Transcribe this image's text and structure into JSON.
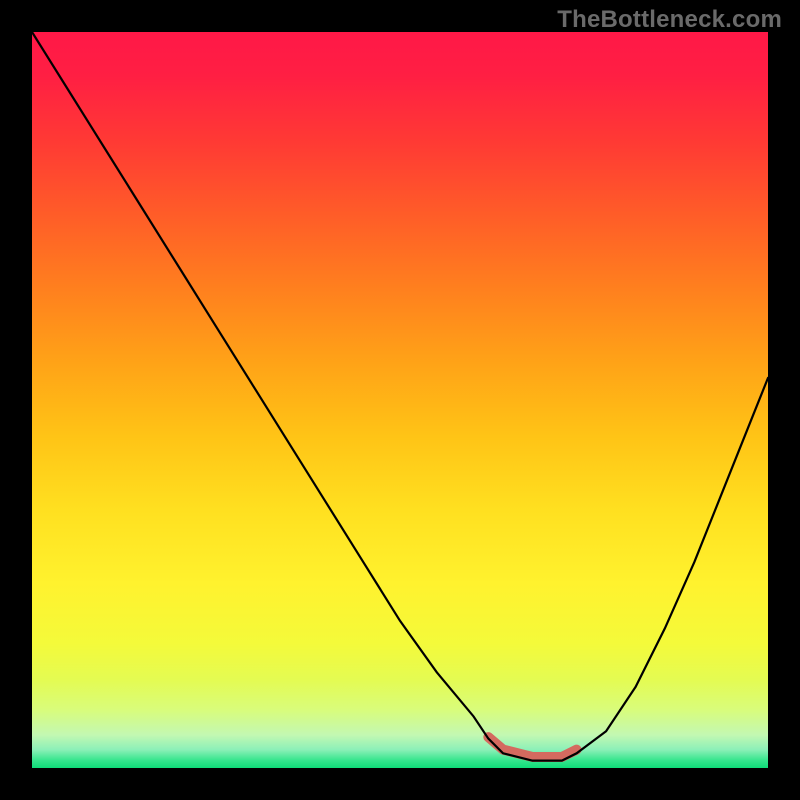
{
  "watermark": "TheBottleneck.com",
  "gradient_stops": [
    {
      "offset": 0.0,
      "color": "#ff1847"
    },
    {
      "offset": 0.06,
      "color": "#ff1f43"
    },
    {
      "offset": 0.15,
      "color": "#ff3a34"
    },
    {
      "offset": 0.25,
      "color": "#ff5d28"
    },
    {
      "offset": 0.35,
      "color": "#ff801e"
    },
    {
      "offset": 0.45,
      "color": "#ffa317"
    },
    {
      "offset": 0.55,
      "color": "#ffc416"
    },
    {
      "offset": 0.65,
      "color": "#ffe020"
    },
    {
      "offset": 0.75,
      "color": "#fff22e"
    },
    {
      "offset": 0.83,
      "color": "#f4fa3a"
    },
    {
      "offset": 0.88,
      "color": "#e4fb52"
    },
    {
      "offset": 0.92,
      "color": "#d9fc7a"
    },
    {
      "offset": 0.955,
      "color": "#c3f8b2"
    },
    {
      "offset": 0.975,
      "color": "#8cf0b8"
    },
    {
      "offset": 0.99,
      "color": "#33e58c"
    },
    {
      "offset": 1.0,
      "color": "#0fdc78"
    }
  ],
  "chart_data": {
    "type": "line",
    "title": "",
    "xlabel": "",
    "ylabel": "",
    "x_range": [
      0,
      100
    ],
    "y_range": [
      0,
      100
    ],
    "grid": false,
    "series": [
      {
        "name": "curve",
        "color": "#000000",
        "x": [
          0,
          5,
          10,
          15,
          20,
          25,
          30,
          35,
          40,
          45,
          50,
          55,
          60,
          62,
          64,
          68,
          72,
          74,
          78,
          82,
          86,
          90,
          94,
          98,
          100
        ],
        "y": [
          100,
          92,
          84,
          76,
          68,
          60,
          52,
          44,
          36,
          28,
          20,
          13,
          7,
          4,
          2,
          1,
          1,
          2,
          5,
          11,
          19,
          28,
          38,
          48,
          53
        ]
      }
    ],
    "marker": {
      "name": "optimal-range",
      "color": "#d46a5f",
      "x": [
        62,
        64,
        68,
        72,
        74
      ],
      "y": [
        4.2,
        2.5,
        1.5,
        1.5,
        2.5
      ],
      "width": 10
    }
  }
}
